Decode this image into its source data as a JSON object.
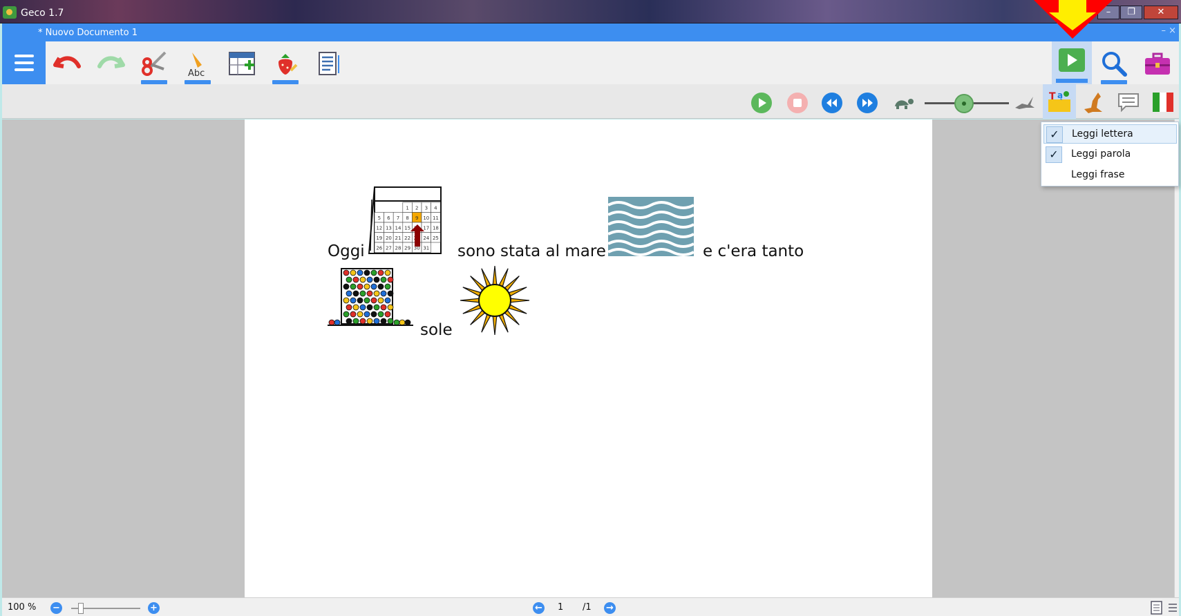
{
  "window": {
    "app_title": "Geco 1.7",
    "minimize_glyph": "–",
    "maximize_glyph": "❐",
    "close_glyph": "✕"
  },
  "document_tab": {
    "title": "* Nuovo Documento 1",
    "close_glyph": "– ×"
  },
  "toolbar": {
    "tools": [
      "menu-icon",
      "undo-icon",
      "redo-icon",
      "scissors-icon",
      "spell-check-icon",
      "table-insert-icon",
      "symbol-insert-icon",
      "document-lines-icon",
      "play-icon",
      "search-icon",
      "briefcase-icon"
    ]
  },
  "reading_bar": {
    "controls": [
      "play-icon",
      "stop-icon",
      "rewind-icon",
      "fast-forward-icon",
      "turtle-icon",
      "speed-slider",
      "hare-icon",
      "read-mode-icon",
      "kangaroo-icon",
      "speech-bubble-icon",
      "italian-flag-icon"
    ],
    "speed_level": 0.5
  },
  "document": {
    "line1": {
      "w1": "Oggi",
      "w2": "sono stata al mare",
      "w3": "e c'era tanto"
    },
    "line2": {
      "w1": "sole"
    },
    "calendar_numbers": [
      "1",
      "2",
      "3",
      "4",
      "5",
      "6",
      "7",
      "8",
      "9",
      "10",
      "11",
      "12",
      "13",
      "14",
      "15",
      "16",
      "17",
      "18",
      "19",
      "20",
      "21",
      "22",
      "23",
      "24",
      "25",
      "26",
      "27",
      "28",
      "29",
      "30",
      "31"
    ]
  },
  "read_menu": {
    "items": [
      {
        "label": "Leggi lettera",
        "checked": true
      },
      {
        "label": "Leggi parola",
        "checked": true
      },
      {
        "label": "Leggi frase",
        "checked": false
      }
    ],
    "check_glyph": "✓"
  },
  "status": {
    "zoom": "100 %",
    "page": "1",
    "total": "/1",
    "zoom_out_glyph": "−",
    "zoom_in_glyph": "+",
    "prev_glyph": "←",
    "next_glyph": "→",
    "zoom_level": 0.1
  },
  "colors": {
    "accent": "#3d8ef0",
    "play_green": "#5cb85c",
    "stop_pink": "#f4b0b0",
    "annotation_red": "#ff0000",
    "annotation_yellow": "#ffee00"
  }
}
